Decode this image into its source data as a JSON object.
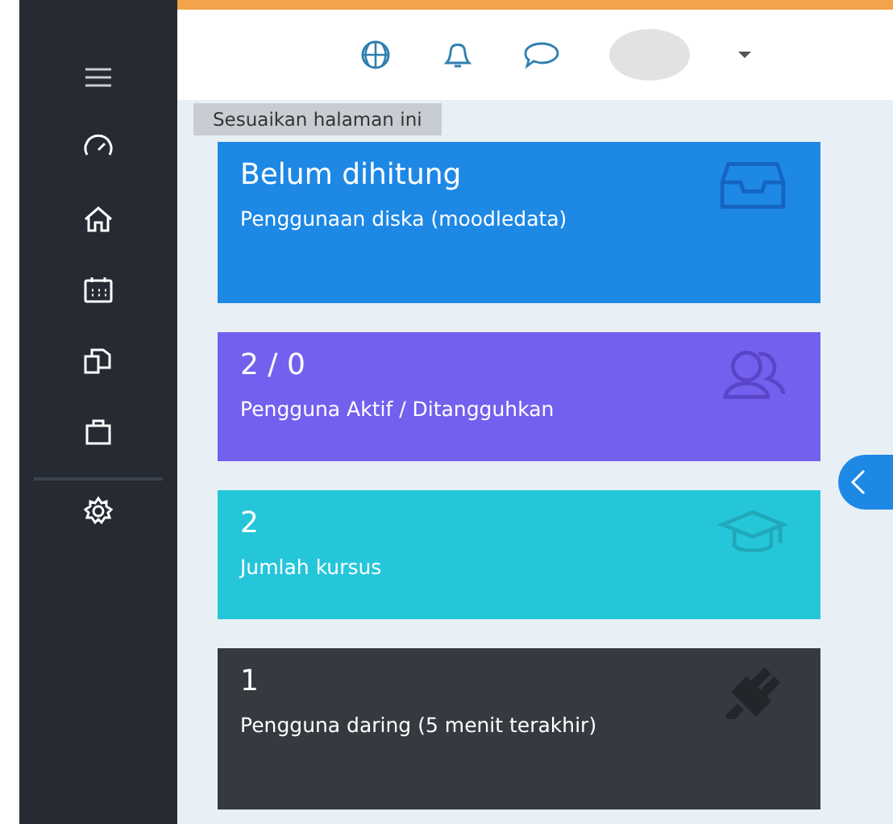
{
  "customize_button": {
    "label": "Sesuaikan halaman ini"
  },
  "cards": [
    {
      "value": "Belum dihitung",
      "label": "Penggunaan diska (moodledata)",
      "color": "#1e88e5"
    },
    {
      "value": "2 / 0",
      "label": "Pengguna Aktif / Ditangguhkan",
      "color": "#7460ee"
    },
    {
      "value": "2",
      "label": "Jumlah kursus",
      "color": "#26c6da"
    },
    {
      "value": "1",
      "label": "Pengguna daring (5 menit terakhir)",
      "color": "#343a40"
    }
  ]
}
